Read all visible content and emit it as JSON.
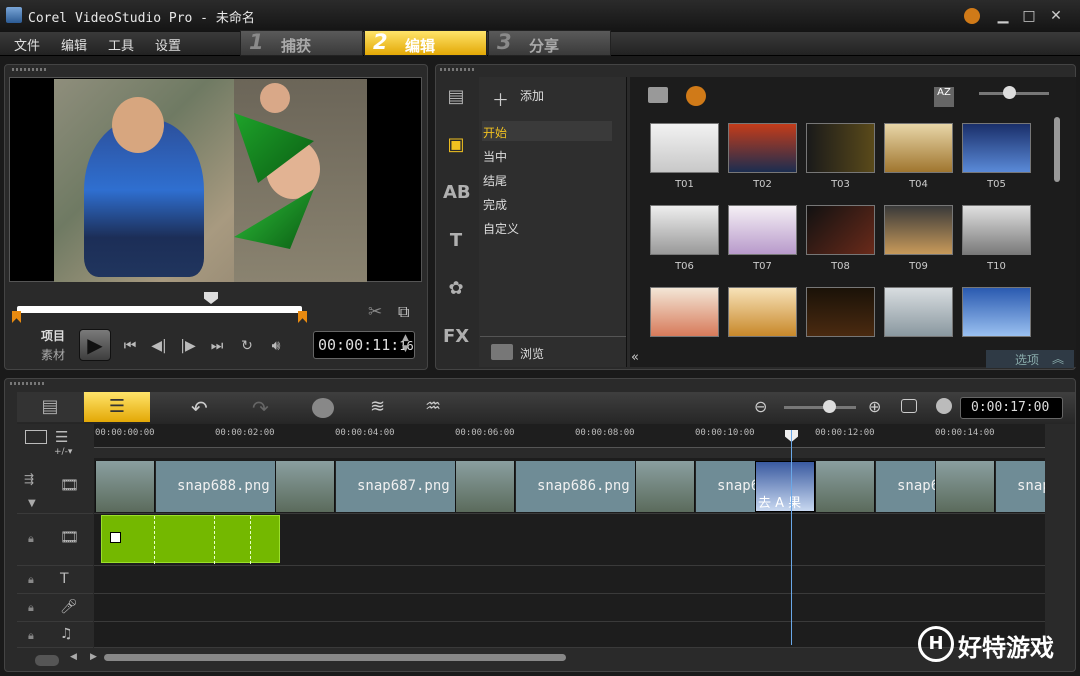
{
  "window": {
    "title": "Corel VideoStudio Pro - 未命名"
  },
  "menu": [
    "文件",
    "编辑",
    "工具",
    "设置"
  ],
  "steps": [
    {
      "num": "1",
      "label": "捕获",
      "active": false
    },
    {
      "num": "2",
      "label": "编辑",
      "active": true
    },
    {
      "num": "3",
      "label": "分享",
      "active": false
    }
  ],
  "preview": {
    "mode_project": "项目",
    "mode_clip": "素材",
    "timecode_main": "00:00:11:",
    "timecode_frame": "16"
  },
  "library": {
    "add_label": "添加",
    "browse_label": "浏览",
    "options_label": "选项",
    "categories": [
      "开始",
      "当中",
      "结尾",
      "完成",
      "自定义"
    ],
    "selected_category": "开始",
    "thumbs": [
      [
        "T01",
        "T02",
        "T03",
        "T04",
        "T05"
      ],
      [
        "T06",
        "T07",
        "T08",
        "T09",
        "T10"
      ],
      [
        "",
        "",
        "",
        "",
        ""
      ]
    ]
  },
  "timeline": {
    "timecode": "0:00:17:00",
    "ruler": [
      "00:00:00:00",
      "00:00:02:00",
      "00:00:04:00",
      "00:00:06:00",
      "00:00:08:00",
      "00:00:10:00",
      "00:00:12:00",
      "00:00:14:00"
    ],
    "clips": [
      "snap688.png",
      "snap687.png",
      "snap686.png",
      "snap6",
      "snap6",
      "snap"
    ],
    "transition_text": "去 A 果"
  },
  "colors": {
    "accent": "#f0c020",
    "overlay_clip": "#74b800",
    "playhead": "#6aa8e8"
  }
}
